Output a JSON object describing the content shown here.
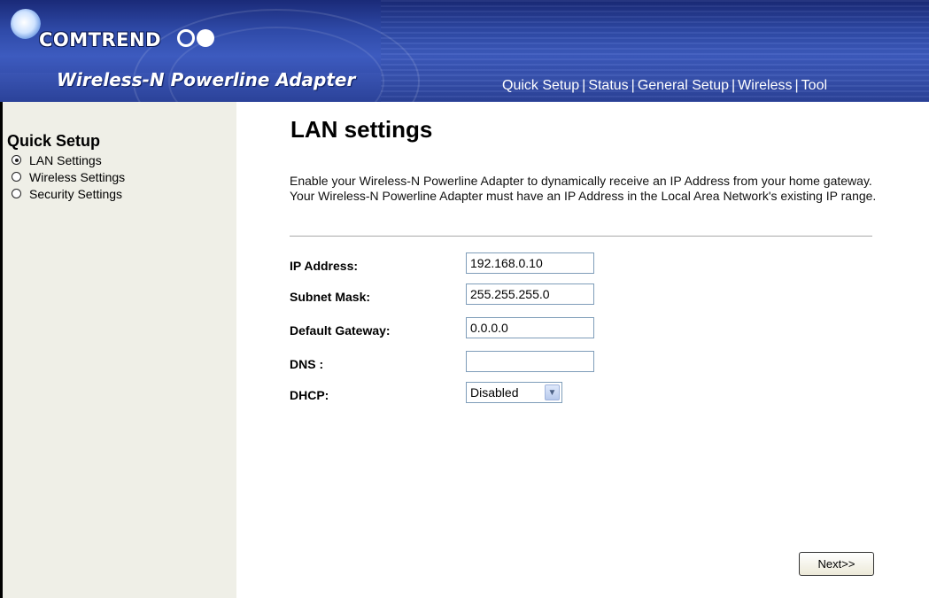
{
  "header": {
    "logo_text": "COMTREND",
    "product_title": "Wireless-N Powerline Adapter",
    "nav": [
      "Quick Setup",
      "Status",
      "General Setup",
      "Wireless",
      "Tool"
    ]
  },
  "sidebar": {
    "title": "Quick Setup",
    "items": [
      {
        "label": "LAN Settings",
        "selected": true
      },
      {
        "label": "Wireless Settings",
        "selected": false
      },
      {
        "label": "Security Settings",
        "selected": false
      }
    ]
  },
  "main": {
    "title": "LAN settings",
    "description": "Enable your Wireless-N Powerline Adapter to dynamically receive an IP Address from your home gateway. Your Wireless-N Powerline Adapter must have an IP Address in the Local Area Network's existing IP range.",
    "fields": {
      "ip_address": {
        "label": "IP Address:",
        "value": "192.168.0.10"
      },
      "subnet_mask": {
        "label": "Subnet Mask:",
        "value": "255.255.255.0"
      },
      "default_gateway": {
        "label": "Default Gateway:",
        "value": "0.0.0.0"
      },
      "dns": {
        "label": "DNS :",
        "value": ""
      },
      "dhcp": {
        "label": "DHCP:",
        "value": "Disabled"
      }
    },
    "next_label": "Next>>"
  },
  "colors": {
    "header_blue": "#2f4aa8",
    "sidebar_bg": "#efefe7"
  },
  "icons": {
    "logo": "comtrend-flower-logo",
    "select": "chevron-down-icon"
  }
}
